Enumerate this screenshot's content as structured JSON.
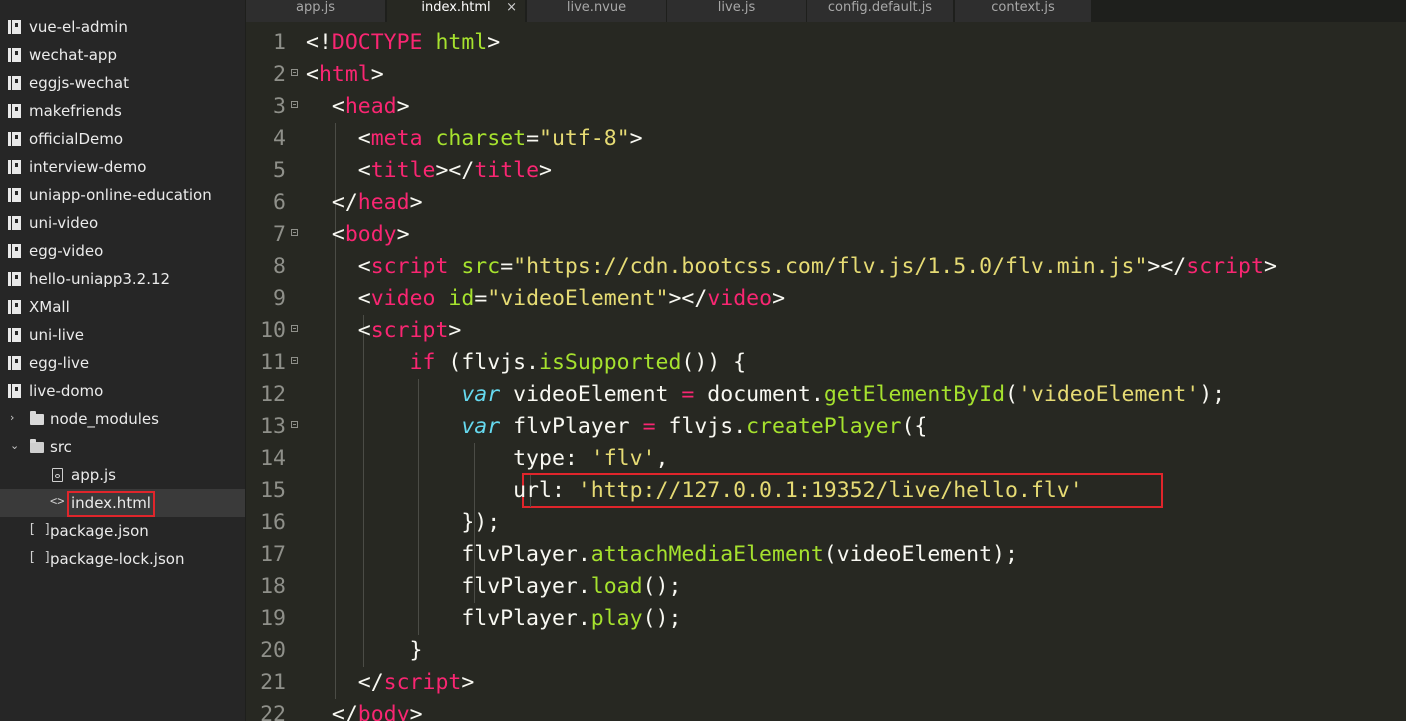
{
  "sidebar": {
    "items": [
      {
        "label": "vue-el-admin",
        "kind": "repo"
      },
      {
        "label": "wechat-app",
        "kind": "repo"
      },
      {
        "label": "eggjs-wechat",
        "kind": "repo"
      },
      {
        "label": "makefriends",
        "kind": "repo"
      },
      {
        "label": "officialDemo",
        "kind": "repo"
      },
      {
        "label": "interview-demo",
        "kind": "repo"
      },
      {
        "label": "uniapp-online-education",
        "kind": "repo"
      },
      {
        "label": "uni-video",
        "kind": "repo"
      },
      {
        "label": "egg-video",
        "kind": "repo"
      },
      {
        "label": "hello-uniapp3.2.12",
        "kind": "repo"
      },
      {
        "label": "XMall",
        "kind": "repo"
      },
      {
        "label": "uni-live",
        "kind": "repo"
      },
      {
        "label": "egg-live",
        "kind": "repo"
      },
      {
        "label": "live-domo",
        "kind": "repo"
      },
      {
        "label": "node_modules",
        "kind": "folder-closed"
      },
      {
        "label": "src",
        "kind": "folder-open"
      },
      {
        "label": "app.js",
        "kind": "file-js"
      },
      {
        "label": "index.html",
        "kind": "file-html",
        "selected": true
      },
      {
        "label": "package.json",
        "kind": "file-json"
      },
      {
        "label": "package-lock.json",
        "kind": "file-json"
      }
    ],
    "chevron_collapsed": "›",
    "chevron_expanded": "⌄",
    "code_glyph": "<>",
    "bracket_glyph": "[ ]"
  },
  "tabs": [
    {
      "label": "app.js"
    },
    {
      "label": "index.html",
      "active": true,
      "close": "×"
    },
    {
      "label": "live.nvue"
    },
    {
      "label": "live.js"
    },
    {
      "label": "config.default.js"
    },
    {
      "label": "context.js"
    }
  ],
  "editor": {
    "lines": [
      {
        "n": "1",
        "fold": false,
        "tokens": [
          [
            "p",
            "<!"
          ],
          [
            "tag",
            "DOCTYPE"
          ],
          [
            "p",
            " "
          ],
          [
            "attr",
            "html"
          ],
          [
            "p",
            ">"
          ]
        ]
      },
      {
        "n": "2",
        "fold": true,
        "tokens": [
          [
            "p",
            "<"
          ],
          [
            "tag",
            "html"
          ],
          [
            "p",
            ">"
          ]
        ]
      },
      {
        "n": "3",
        "fold": true,
        "tokens": [
          [
            "p",
            "  <"
          ],
          [
            "tag",
            "head"
          ],
          [
            "p",
            ">"
          ]
        ]
      },
      {
        "n": "4",
        "fold": false,
        "tokens": [
          [
            "p",
            "    <"
          ],
          [
            "tag",
            "meta"
          ],
          [
            "p",
            " "
          ],
          [
            "attr",
            "charset"
          ],
          [
            "p",
            "="
          ],
          [
            "str",
            "\"utf-8\""
          ],
          [
            "p",
            ">"
          ]
        ]
      },
      {
        "n": "5",
        "fold": false,
        "tokens": [
          [
            "p",
            "    <"
          ],
          [
            "tag",
            "title"
          ],
          [
            "p",
            "></"
          ],
          [
            "tag",
            "title"
          ],
          [
            "p",
            ">"
          ]
        ]
      },
      {
        "n": "6",
        "fold": false,
        "tokens": [
          [
            "p",
            "  </"
          ],
          [
            "tag",
            "head"
          ],
          [
            "p",
            ">"
          ]
        ]
      },
      {
        "n": "7",
        "fold": true,
        "tokens": [
          [
            "p",
            "  <"
          ],
          [
            "tag",
            "body"
          ],
          [
            "p",
            ">"
          ]
        ]
      },
      {
        "n": "8",
        "fold": false,
        "tokens": [
          [
            "p",
            "    <"
          ],
          [
            "tag",
            "script"
          ],
          [
            "p",
            " "
          ],
          [
            "attr",
            "src"
          ],
          [
            "p",
            "="
          ],
          [
            "str",
            "\"https://cdn.bootcss.com/flv.js/1.5.0/flv.min.js\""
          ],
          [
            "p",
            "></"
          ],
          [
            "tag",
            "script"
          ],
          [
            "p",
            ">"
          ]
        ]
      },
      {
        "n": "9",
        "fold": false,
        "tokens": [
          [
            "p",
            "    <"
          ],
          [
            "tag",
            "video"
          ],
          [
            "p",
            " "
          ],
          [
            "attr",
            "id"
          ],
          [
            "p",
            "="
          ],
          [
            "str",
            "\"videoElement\""
          ],
          [
            "p",
            "></"
          ],
          [
            "tag",
            "video"
          ],
          [
            "p",
            ">"
          ]
        ]
      },
      {
        "n": "10",
        "fold": true,
        "tokens": [
          [
            "p",
            "    <"
          ],
          [
            "tag",
            "script"
          ],
          [
            "p",
            ">"
          ]
        ]
      },
      {
        "n": "11",
        "fold": true,
        "tokens": [
          [
            "p",
            "        "
          ],
          [
            "kw",
            "if"
          ],
          [
            "p",
            " (flvjs."
          ],
          [
            "fn",
            "isSupported"
          ],
          [
            "p",
            "()) {"
          ]
        ]
      },
      {
        "n": "12",
        "fold": false,
        "tokens": [
          [
            "p",
            "            "
          ],
          [
            "var",
            "var"
          ],
          [
            "p",
            " videoElement "
          ],
          [
            "kw",
            "="
          ],
          [
            "p",
            " document."
          ],
          [
            "fn",
            "getElementById"
          ],
          [
            "p",
            "("
          ],
          [
            "str",
            "'videoElement'"
          ],
          [
            "p",
            ");"
          ]
        ]
      },
      {
        "n": "13",
        "fold": true,
        "tokens": [
          [
            "p",
            "            "
          ],
          [
            "var",
            "var"
          ],
          [
            "p",
            " flvPlayer "
          ],
          [
            "kw",
            "="
          ],
          [
            "p",
            " flvjs."
          ],
          [
            "fn",
            "createPlayer"
          ],
          [
            "p",
            "({"
          ]
        ]
      },
      {
        "n": "14",
        "fold": false,
        "tokens": [
          [
            "p",
            "                type: "
          ],
          [
            "str",
            "'flv'"
          ],
          [
            "p",
            ","
          ]
        ]
      },
      {
        "n": "15",
        "fold": false,
        "tokens": [
          [
            "p",
            "                url: "
          ],
          [
            "str",
            "'http://127.0.0.1:19352/live/hello.flv'"
          ]
        ]
      },
      {
        "n": "16",
        "fold": false,
        "tokens": [
          [
            "p",
            "            });"
          ]
        ]
      },
      {
        "n": "17",
        "fold": false,
        "tokens": [
          [
            "p",
            "            flvPlayer."
          ],
          [
            "fn",
            "attachMediaElement"
          ],
          [
            "p",
            "(videoElement);"
          ]
        ]
      },
      {
        "n": "18",
        "fold": false,
        "tokens": [
          [
            "p",
            "            flvPlayer."
          ],
          [
            "fn",
            "load"
          ],
          [
            "p",
            "();"
          ]
        ]
      },
      {
        "n": "19",
        "fold": false,
        "tokens": [
          [
            "p",
            "            flvPlayer."
          ],
          [
            "fn",
            "play"
          ],
          [
            "p",
            "();"
          ]
        ]
      },
      {
        "n": "20",
        "fold": false,
        "tokens": [
          [
            "p",
            "        }"
          ]
        ]
      },
      {
        "n": "21",
        "fold": false,
        "tokens": [
          [
            "p",
            "    </"
          ],
          [
            "tag",
            "script"
          ],
          [
            "p",
            ">"
          ]
        ]
      },
      {
        "n": "22",
        "fold": false,
        "tokens": [
          [
            "p",
            "  </"
          ],
          [
            "tag",
            "body"
          ],
          [
            "p",
            ">"
          ]
        ]
      }
    ]
  },
  "theme": {
    "background": "#272822",
    "sidebar_bg": "#262626",
    "highlight_box": "#e0252b"
  }
}
